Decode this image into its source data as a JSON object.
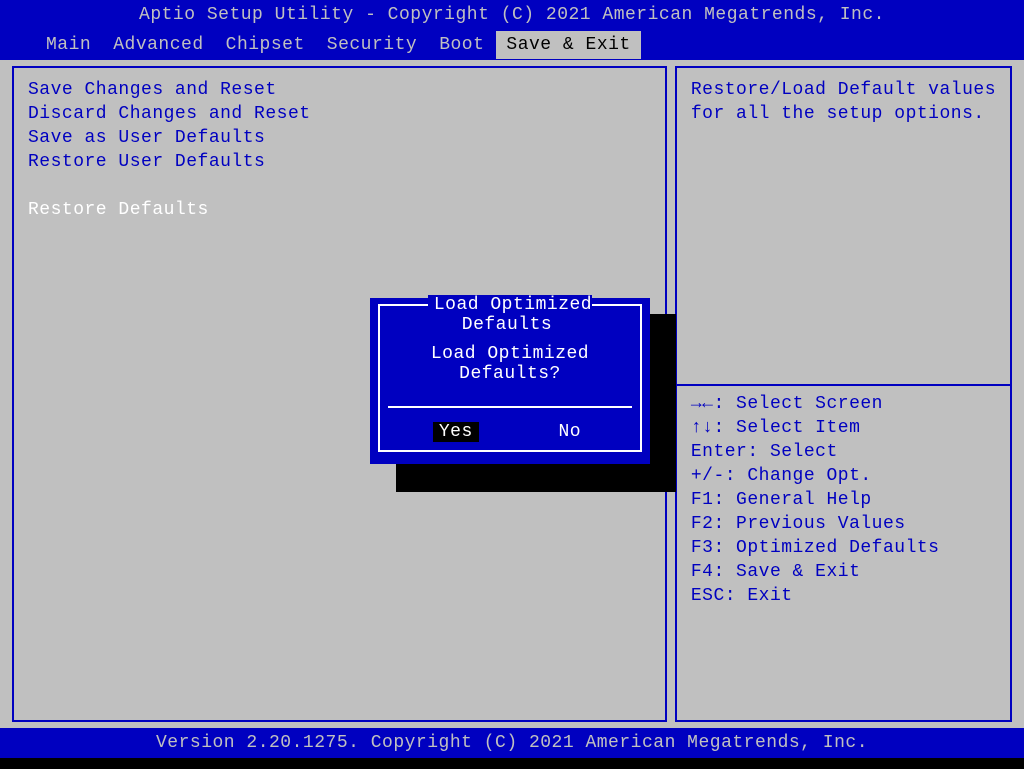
{
  "header": {
    "title": "Aptio Setup Utility - Copyright (C) 2021 American Megatrends, Inc."
  },
  "menu": {
    "items": [
      "Main",
      "Advanced",
      "Chipset",
      "Security",
      "Boot",
      "Save & Exit"
    ],
    "active_index": 5
  },
  "left": {
    "options": [
      {
        "label": "Save Changes and Reset",
        "selected": false
      },
      {
        "label": "Discard Changes and Reset",
        "selected": false
      },
      {
        "label": "Save as User Defaults",
        "selected": false
      },
      {
        "label": "Restore User Defaults",
        "selected": false
      }
    ],
    "selected_option": {
      "label": "Restore Defaults"
    }
  },
  "right": {
    "description_line1": "Restore/Load Default values",
    "description_line2": "for all the setup options.",
    "keys": {
      "select_screen_sym": "→←",
      "select_screen": ": Select Screen",
      "select_item_sym": "↑↓",
      "select_item": ": Select Item",
      "enter": "Enter: Select",
      "change": "+/-: Change Opt.",
      "f1": "F1: General Help",
      "f2": "F2: Previous Values",
      "f3": "F3: Optimized Defaults",
      "f4": "F4: Save & Exit",
      "esc": "ESC: Exit"
    }
  },
  "dialog": {
    "title": "Load Optimized Defaults",
    "message": "Load Optimized Defaults?",
    "yes": "Yes",
    "no": "No",
    "selected": "yes"
  },
  "footer": {
    "text": "Version 2.20.1275. Copyright (C) 2021 American Megatrends, Inc."
  }
}
